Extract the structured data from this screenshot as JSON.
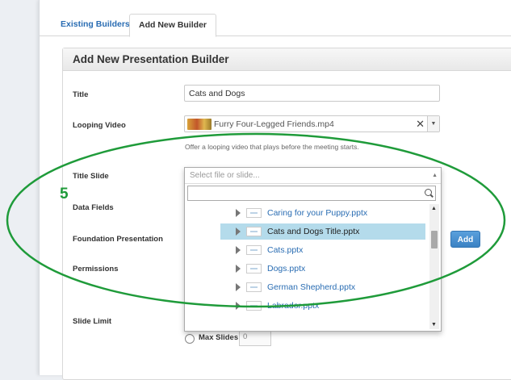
{
  "tabs": [
    {
      "label": "Existing Builders",
      "active": false
    },
    {
      "label": "Add New Builder",
      "active": true
    }
  ],
  "panel": {
    "title": "Add New Presentation Builder"
  },
  "form": {
    "title_label": "Title",
    "title_value": "Cats and Dogs",
    "looping_label": "Looping Video",
    "looping_value": "Furry Four-Legged Friends.mp4",
    "looping_help": "Offer a looping video that plays before the meeting starts.",
    "title_slide_label": "Title Slide",
    "title_slide_placeholder": "Select file or slide...",
    "data_fields_label": "Data Fields",
    "foundation_label": "Foundation Presentation",
    "add_label": "Add",
    "permissions_label": "Permissions",
    "slide_limit_label": "Slide Limit",
    "max_slides_label": "Max Slides",
    "max_slides_value": "0"
  },
  "dropdown": {
    "search_value": "",
    "items": [
      {
        "label": "Caring for your Puppy.pptx",
        "selected": false
      },
      {
        "label": "Cats and Dogs Title.pptx",
        "selected": true
      },
      {
        "label": "Cats.pptx",
        "selected": false
      },
      {
        "label": "Dogs.pptx",
        "selected": false
      },
      {
        "label": "German Shepherd.pptx",
        "selected": false
      },
      {
        "label": "Labrador.pptx",
        "selected": false
      }
    ]
  },
  "annotation": {
    "step": "5",
    "color": "#1f9b3a"
  },
  "colors": {
    "link": "#2a6db3",
    "selection": "#b4dbeb",
    "add_button": "#3b82c4"
  }
}
